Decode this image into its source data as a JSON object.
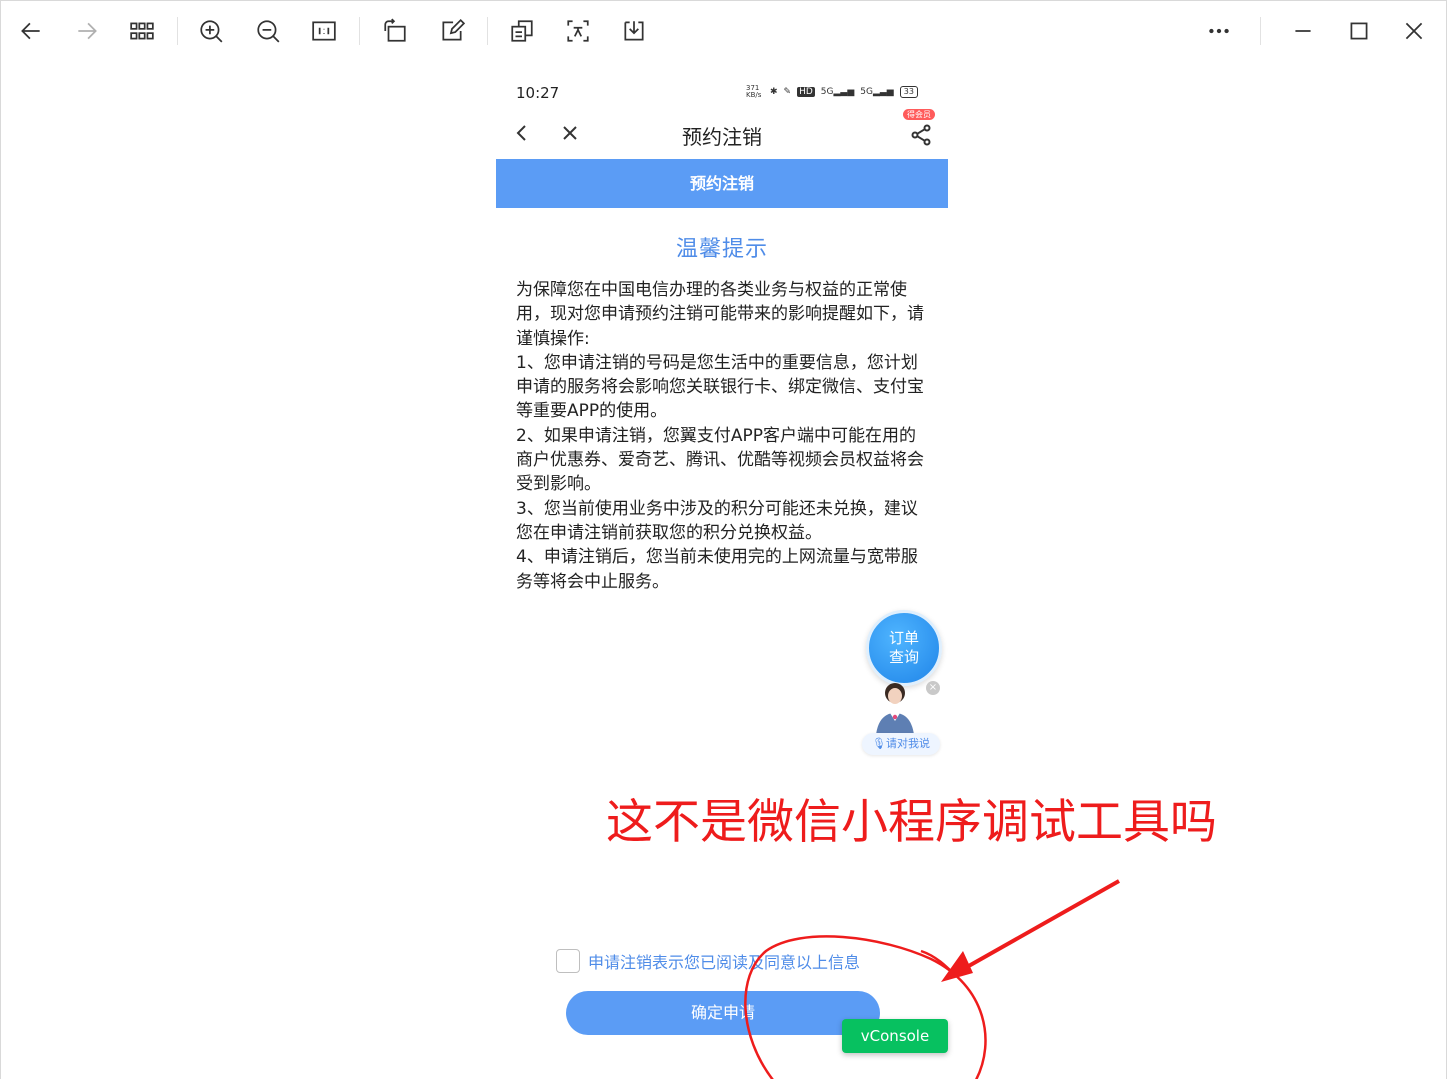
{
  "toolbar": {
    "buttons": [
      {
        "name": "back-arrow-icon"
      },
      {
        "name": "forward-arrow-icon"
      },
      {
        "name": "grid-view-icon"
      },
      {
        "name": "zoom-in-icon"
      },
      {
        "name": "zoom-out-icon"
      },
      {
        "name": "actual-size-icon"
      },
      {
        "name": "rotate-icon"
      },
      {
        "name": "edit-icon"
      },
      {
        "name": "copy-icon"
      },
      {
        "name": "text-recognition-icon"
      },
      {
        "name": "download-icon"
      }
    ],
    "window": [
      "more-icon",
      "minimize-icon",
      "maximize-icon",
      "close-icon"
    ]
  },
  "phone": {
    "status": {
      "time": "10:27",
      "speed": "371 KB/s",
      "hd": "HD",
      "signal1": "5G",
      "signal2": "5G",
      "battery": "33"
    },
    "nav": {
      "title": "预约注销",
      "badge": "得会员"
    },
    "tab_bar": "预约注销",
    "tip_title": "温馨提示",
    "tip_paragraphs": [
      "为保障您在中国电信办理的各类业务与权益的正常使用，现对您申请预约注销可能带来的影响提醒如下，请谨慎操作:",
      "1、您申请注销的号码是您生活中的重要信息，您计划申请的服务将会影响您关联银行卡、绑定微信、支付宝等重要APP的使用。",
      "2、如果申请注销，您翼支付APP客户端中可能在用的商户优惠券、爱奇艺、腾讯、优酷等视频会员权益将会受到影响。",
      "3、您当前使用业务中涉及的积分可能还未兑换，建议您在申请注销前获取您的积分兑换权益。",
      "4、申请注销后，您当前未使用完的上网流量与宽带服务等将会中止服务。"
    ],
    "order_bubble": "订单查询",
    "assistant_label": "请对我说",
    "agree_text": "申请注销表示您已阅读及同意以上信息",
    "confirm_label": "确定申请",
    "vconsole_label": "vConsole"
  },
  "annotation": {
    "text": "这不是微信小程序调试工具吗",
    "color": "#ee1c1c"
  },
  "colors": {
    "accent_blue": "#5b9cf5",
    "title_blue": "#4f8ce8",
    "vconsole_green": "#07c160"
  }
}
